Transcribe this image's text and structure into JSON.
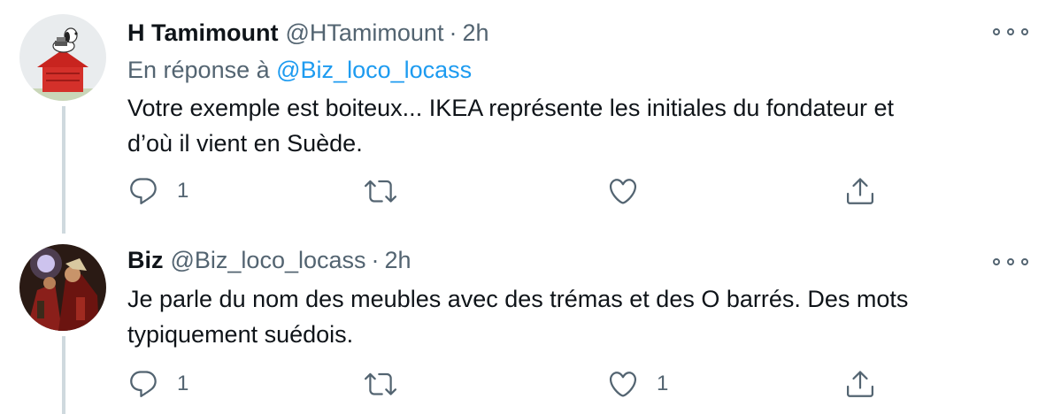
{
  "tweets": [
    {
      "author_name": "H Tamimount",
      "handle": "@HTamimount",
      "separator": "·",
      "time": "2h",
      "reply_prefix": "En réponse à",
      "reply_mention": "@Biz_loco_locass",
      "text_lines": [
        "Votre exemple est boiteux... IKEA représente les initiales du fondateur et",
        "d’où il vient en Suède."
      ],
      "avatar_icon": "snoopy-doghouse-avatar",
      "actions": {
        "reply_count": "1",
        "retweet_count": "",
        "like_count": ""
      }
    },
    {
      "author_name": "Biz",
      "handle": "@Biz_loco_locass",
      "separator": "·",
      "time": "2h",
      "text_lines": [
        "Je parle du nom des meubles avec des trémas et des O barrés. Des mots",
        "typiquement suédois."
      ],
      "avatar_icon": "photo-avatar",
      "actions": {
        "reply_count": "1",
        "retweet_count": "",
        "like_count": "1"
      }
    }
  ],
  "colors": {
    "text": "#0f1419",
    "secondary": "#536471",
    "link": "#1d9bf0",
    "thread_line": "#cfd9de"
  }
}
